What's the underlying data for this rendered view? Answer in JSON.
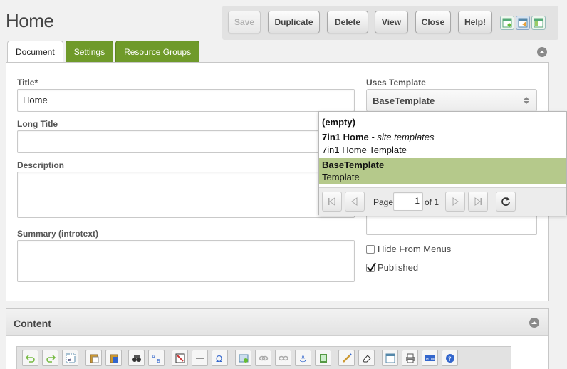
{
  "page": {
    "title": "Home"
  },
  "toolbar": {
    "save": "Save",
    "duplicate": "Duplicate",
    "delete": "Delete",
    "view": "View",
    "close": "Close",
    "help": "Help!"
  },
  "tabs": [
    "Document",
    "Settings",
    "Resource Groups"
  ],
  "form": {
    "title_label": "Title*",
    "title_value": "Home",
    "long_title_label": "Long Title",
    "long_title_value": "",
    "description_label": "Description",
    "description_value": "",
    "summary_label": "Summary (introtext)",
    "summary_value": "",
    "template_label": "Uses Template",
    "template_value": "BaseTemplate",
    "hide_menus_label": "Hide From Menus",
    "hide_menus_checked": false,
    "published_label": "Published",
    "published_checked": true
  },
  "dropdown": {
    "items": [
      {
        "name": "(empty)"
      },
      {
        "name": "7in1 Home",
        "category": "- site templates",
        "desc": "7in1 Home Template"
      },
      {
        "name": "BaseTemplate",
        "desc": "Template",
        "selected": true
      }
    ],
    "pager": {
      "page_label": "Page",
      "page_value": "1",
      "of_label": "of 1"
    }
  },
  "content": {
    "title": "Content"
  },
  "colors": {
    "tab_green": "#6f9a2a",
    "selected_row": "#b5c98b"
  },
  "editor_icons": [
    "undo-icon",
    "redo-icon",
    "select-all-icon",
    "paste-icon",
    "paste-word-icon",
    "find-icon",
    "replace-icon",
    "cleanup-icon",
    "horizontal-rule-icon",
    "special-char-icon",
    "insert-image-icon",
    "link-icon",
    "unlink-icon",
    "anchor-icon",
    "media-icon",
    "style-icon",
    "erase-icon",
    "template-icon",
    "print-icon",
    "html-icon",
    "help-icon"
  ]
}
